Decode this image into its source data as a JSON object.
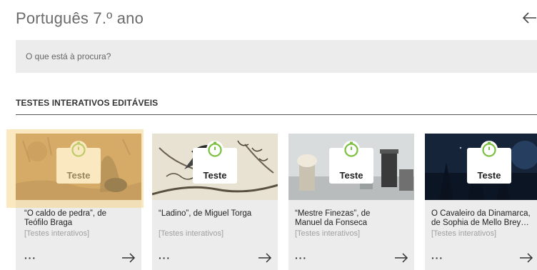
{
  "header": {
    "title": "Português 7.º ano",
    "back_icon": "arrow-left-icon"
  },
  "search": {
    "placeholder": "O que está à procura?"
  },
  "section": {
    "title": "TESTES INTERATIVOS EDITÁVEIS"
  },
  "cards": [
    {
      "badge": "Teste",
      "title_line1": "“O caldo de pedra”, de",
      "title_line2": "Teófilo Braga",
      "category": "[Testes interativos]",
      "more": "···",
      "highlighted": true
    },
    {
      "badge": "Teste",
      "title_line1": "“Ladino”, de Miguel Torga",
      "title_line2": "",
      "category": "[Testes interativos]",
      "more": "···",
      "highlighted": false
    },
    {
      "badge": "Teste",
      "title_line1": "“Mestre Finezas”, de",
      "title_line2": "Manuel da Fonseca",
      "category": "[Testes interativos]",
      "more": "···",
      "highlighted": false
    },
    {
      "badge": "Teste",
      "title_line1": "O Cavaleiro da Dinamarca,",
      "title_line2": "de Sophia de Mello Brey…",
      "category": "[Testes interativos]",
      "more": "···",
      "highlighted": false
    }
  ],
  "colors": {
    "accent_green": "#7bbf3f",
    "card_bg": "#ececec",
    "highlight": "#f5d68c"
  }
}
